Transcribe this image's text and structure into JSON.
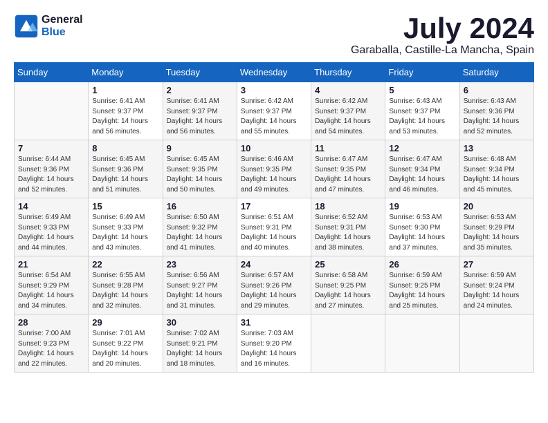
{
  "logo": {
    "line1": "General",
    "line2": "Blue"
  },
  "title": "July 2024",
  "subtitle": "Garaballa, Castille-La Mancha, Spain",
  "headers": [
    "Sunday",
    "Monday",
    "Tuesday",
    "Wednesday",
    "Thursday",
    "Friday",
    "Saturday"
  ],
  "weeks": [
    [
      {
        "day": "",
        "info": ""
      },
      {
        "day": "1",
        "info": "Sunrise: 6:41 AM\nSunset: 9:37 PM\nDaylight: 14 hours\nand 56 minutes."
      },
      {
        "day": "2",
        "info": "Sunrise: 6:41 AM\nSunset: 9:37 PM\nDaylight: 14 hours\nand 56 minutes."
      },
      {
        "day": "3",
        "info": "Sunrise: 6:42 AM\nSunset: 9:37 PM\nDaylight: 14 hours\nand 55 minutes."
      },
      {
        "day": "4",
        "info": "Sunrise: 6:42 AM\nSunset: 9:37 PM\nDaylight: 14 hours\nand 54 minutes."
      },
      {
        "day": "5",
        "info": "Sunrise: 6:43 AM\nSunset: 9:37 PM\nDaylight: 14 hours\nand 53 minutes."
      },
      {
        "day": "6",
        "info": "Sunrise: 6:43 AM\nSunset: 9:36 PM\nDaylight: 14 hours\nand 52 minutes."
      }
    ],
    [
      {
        "day": "7",
        "info": "Sunrise: 6:44 AM\nSunset: 9:36 PM\nDaylight: 14 hours\nand 52 minutes."
      },
      {
        "day": "8",
        "info": "Sunrise: 6:45 AM\nSunset: 9:36 PM\nDaylight: 14 hours\nand 51 minutes."
      },
      {
        "day": "9",
        "info": "Sunrise: 6:45 AM\nSunset: 9:35 PM\nDaylight: 14 hours\nand 50 minutes."
      },
      {
        "day": "10",
        "info": "Sunrise: 6:46 AM\nSunset: 9:35 PM\nDaylight: 14 hours\nand 49 minutes."
      },
      {
        "day": "11",
        "info": "Sunrise: 6:47 AM\nSunset: 9:35 PM\nDaylight: 14 hours\nand 47 minutes."
      },
      {
        "day": "12",
        "info": "Sunrise: 6:47 AM\nSunset: 9:34 PM\nDaylight: 14 hours\nand 46 minutes."
      },
      {
        "day": "13",
        "info": "Sunrise: 6:48 AM\nSunset: 9:34 PM\nDaylight: 14 hours\nand 45 minutes."
      }
    ],
    [
      {
        "day": "14",
        "info": "Sunrise: 6:49 AM\nSunset: 9:33 PM\nDaylight: 14 hours\nand 44 minutes."
      },
      {
        "day": "15",
        "info": "Sunrise: 6:49 AM\nSunset: 9:33 PM\nDaylight: 14 hours\nand 43 minutes."
      },
      {
        "day": "16",
        "info": "Sunrise: 6:50 AM\nSunset: 9:32 PM\nDaylight: 14 hours\nand 41 minutes."
      },
      {
        "day": "17",
        "info": "Sunrise: 6:51 AM\nSunset: 9:31 PM\nDaylight: 14 hours\nand 40 minutes."
      },
      {
        "day": "18",
        "info": "Sunrise: 6:52 AM\nSunset: 9:31 PM\nDaylight: 14 hours\nand 38 minutes."
      },
      {
        "day": "19",
        "info": "Sunrise: 6:53 AM\nSunset: 9:30 PM\nDaylight: 14 hours\nand 37 minutes."
      },
      {
        "day": "20",
        "info": "Sunrise: 6:53 AM\nSunset: 9:29 PM\nDaylight: 14 hours\nand 35 minutes."
      }
    ],
    [
      {
        "day": "21",
        "info": "Sunrise: 6:54 AM\nSunset: 9:29 PM\nDaylight: 14 hours\nand 34 minutes."
      },
      {
        "day": "22",
        "info": "Sunrise: 6:55 AM\nSunset: 9:28 PM\nDaylight: 14 hours\nand 32 minutes."
      },
      {
        "day": "23",
        "info": "Sunrise: 6:56 AM\nSunset: 9:27 PM\nDaylight: 14 hours\nand 31 minutes."
      },
      {
        "day": "24",
        "info": "Sunrise: 6:57 AM\nSunset: 9:26 PM\nDaylight: 14 hours\nand 29 minutes."
      },
      {
        "day": "25",
        "info": "Sunrise: 6:58 AM\nSunset: 9:25 PM\nDaylight: 14 hours\nand 27 minutes."
      },
      {
        "day": "26",
        "info": "Sunrise: 6:59 AM\nSunset: 9:25 PM\nDaylight: 14 hours\nand 25 minutes."
      },
      {
        "day": "27",
        "info": "Sunrise: 6:59 AM\nSunset: 9:24 PM\nDaylight: 14 hours\nand 24 minutes."
      }
    ],
    [
      {
        "day": "28",
        "info": "Sunrise: 7:00 AM\nSunset: 9:23 PM\nDaylight: 14 hours\nand 22 minutes."
      },
      {
        "day": "29",
        "info": "Sunrise: 7:01 AM\nSunset: 9:22 PM\nDaylight: 14 hours\nand 20 minutes."
      },
      {
        "day": "30",
        "info": "Sunrise: 7:02 AM\nSunset: 9:21 PM\nDaylight: 14 hours\nand 18 minutes."
      },
      {
        "day": "31",
        "info": "Sunrise: 7:03 AM\nSunset: 9:20 PM\nDaylight: 14 hours\nand 16 minutes."
      },
      {
        "day": "",
        "info": ""
      },
      {
        "day": "",
        "info": ""
      },
      {
        "day": "",
        "info": ""
      }
    ]
  ]
}
